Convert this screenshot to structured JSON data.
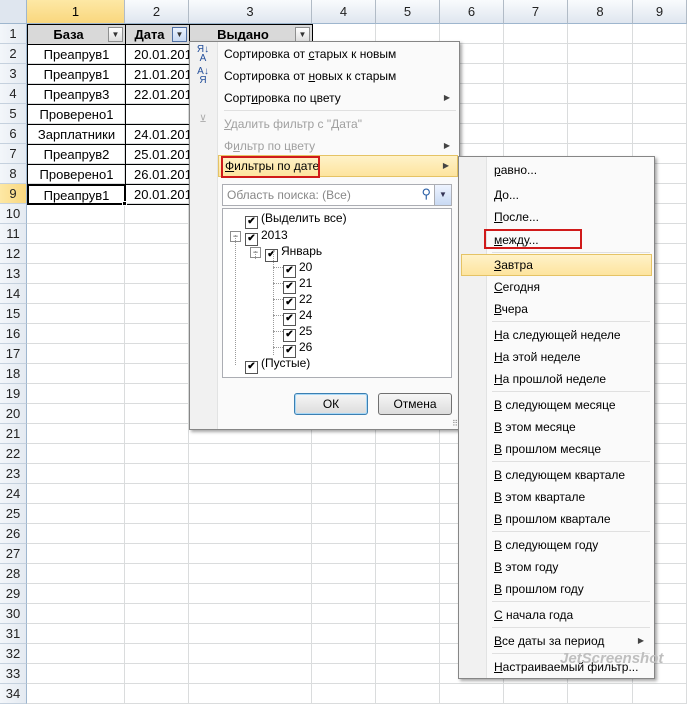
{
  "sheet": {
    "columns": [
      "1",
      "2",
      "3",
      "4",
      "5",
      "6",
      "7",
      "8",
      "9"
    ],
    "rows": [
      "1",
      "2",
      "3",
      "4",
      "5",
      "6",
      "7",
      "8",
      "9",
      "10",
      "11",
      "12",
      "13",
      "14",
      "15",
      "16",
      "17",
      "18",
      "19",
      "20",
      "21",
      "22",
      "23",
      "24",
      "25",
      "26",
      "27",
      "28",
      "29",
      "30",
      "31",
      "32",
      "33",
      "34"
    ],
    "headers": {
      "a": "База",
      "b": "Дата",
      "c": "Выдано"
    },
    "data": [
      {
        "a": "Преапрув1",
        "b": "20.01.201"
      },
      {
        "a": "Преапрув1",
        "b": "21.01.201"
      },
      {
        "a": "Преапрув3",
        "b": "22.01.201"
      },
      {
        "a": "Проверено1",
        "b": ""
      },
      {
        "a": "Зарплатники",
        "b": "24.01.201"
      },
      {
        "a": "Преапрув2",
        "b": "25.01.201"
      },
      {
        "a": "Проверено1",
        "b": "26.01.201"
      },
      {
        "a": "Преапрув1",
        "b": "20.01.201"
      }
    ],
    "filter_button_glyph": "▼"
  },
  "menu": {
    "sort_asc": {
      "pre": "Сортировка от ",
      "u": "с",
      "post": "тарых к новым"
    },
    "sort_desc": {
      "pre": "Сортировка от ",
      "u": "н",
      "post": "овых к старым"
    },
    "sort_color": {
      "pre": "Сорт",
      "u": "и",
      "post": "ровка по цвету"
    },
    "clear_filter": {
      "pre": "",
      "u": "У",
      "post": "далить фильтр с \"Дата\""
    },
    "color_filter": {
      "pre": "Ф",
      "u": "и",
      "post": "льтр по цвету"
    },
    "date_filters": {
      "pre": "",
      "u": "Ф",
      "post": "ильтры по дате"
    },
    "search_placeholder": "Область поиска: (Все)",
    "tree": {
      "select_all": "(Выделить все)",
      "year": "2013",
      "month": "Январь",
      "days": [
        "20",
        "21",
        "22",
        "24",
        "25",
        "26"
      ],
      "blanks": "(Пустые)"
    },
    "check_mark": "✔",
    "ok_label": "ОК",
    "cancel_label": "Отмена"
  },
  "submenu": {
    "items": [
      {
        "id": "equals",
        "pre": "",
        "u": "р",
        "post": "авно..."
      },
      {
        "id": "before",
        "pre": "",
        "u": "Д",
        "post": "о..."
      },
      {
        "id": "after",
        "pre": "",
        "u": "П",
        "post": "осле..."
      },
      {
        "id": "between",
        "pre": "",
        "u": "м",
        "post": "ежду..."
      },
      {
        "id": "tomorrow",
        "pre": "",
        "u": "З",
        "post": "автра"
      },
      {
        "id": "today",
        "pre": "",
        "u": "С",
        "post": "егодня"
      },
      {
        "id": "yesterday",
        "pre": "",
        "u": "В",
        "post": "чера"
      },
      {
        "id": "next-week",
        "pre": "",
        "u": "Н",
        "post": "а следующей неделе"
      },
      {
        "id": "this-week",
        "pre": "",
        "u": "Н",
        "post": "а этой неделе"
      },
      {
        "id": "last-week",
        "pre": "",
        "u": "Н",
        "post": "а прошлой неделе"
      },
      {
        "id": "next-month",
        "pre": "",
        "u": "В",
        "post": " следующем месяце"
      },
      {
        "id": "this-month",
        "pre": "",
        "u": "В",
        "post": " этом месяце"
      },
      {
        "id": "last-month",
        "pre": "",
        "u": "В",
        "post": " прошлом месяце"
      },
      {
        "id": "next-quarter",
        "pre": "",
        "u": "В",
        "post": " следующем квартале"
      },
      {
        "id": "this-quarter",
        "pre": "",
        "u": "В",
        "post": " этом квартале"
      },
      {
        "id": "last-quarter",
        "pre": "",
        "u": "В",
        "post": " прошлом квартале"
      },
      {
        "id": "next-year",
        "pre": "",
        "u": "В",
        "post": " следующем году"
      },
      {
        "id": "this-year",
        "pre": "",
        "u": "В",
        "post": " этом году"
      },
      {
        "id": "last-year",
        "pre": "",
        "u": "В",
        "post": " прошлом году"
      },
      {
        "id": "ytd",
        "pre": "",
        "u": "С",
        "post": " начала года"
      },
      {
        "id": "all-dates",
        "pre": "",
        "u": "В",
        "post": "се даты за период"
      },
      {
        "id": "custom",
        "pre": "",
        "u": "Н",
        "post": "астраиваемый фильтр..."
      }
    ]
  },
  "watermark": "JetScreenshot",
  "colors": {
    "highlight": "#fde49f",
    "red_box": "#d01a1a",
    "header_fill": "#d9d9d9",
    "selected_header": "#f9d77e"
  }
}
